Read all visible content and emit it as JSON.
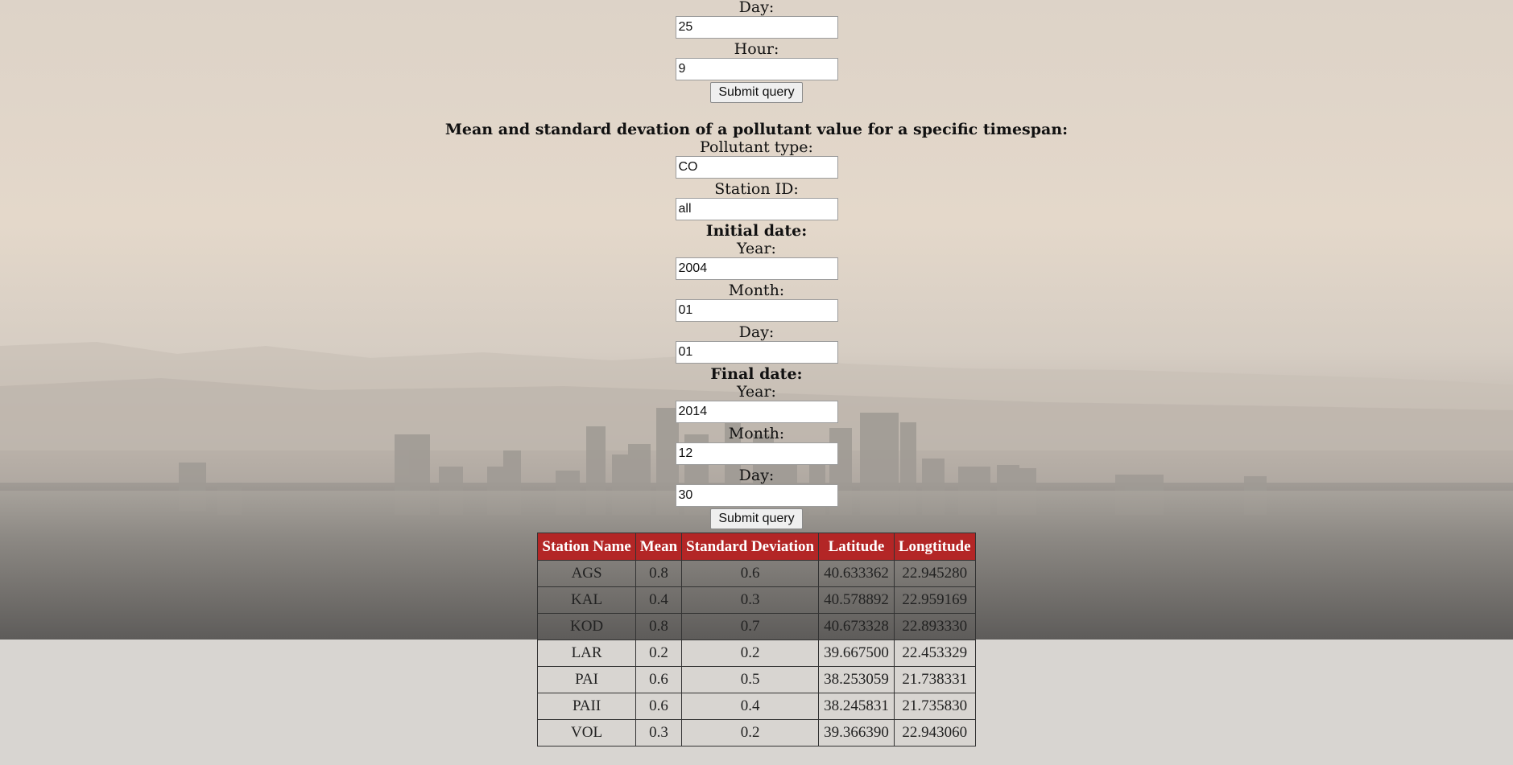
{
  "query1": {
    "day_label": "Day:",
    "day_value": "25",
    "hour_label": "Hour:",
    "hour_value": "9",
    "submit_label": "Submit query"
  },
  "query2": {
    "title": "Mean and standard devation of a pollutant value for a specific timespan:",
    "pollutant_label": "Pollutant type:",
    "pollutant_value": "CO",
    "station_label": "Station ID:",
    "station_value": "all",
    "initial_label": "Initial date:",
    "initial_year_label": "Year:",
    "initial_year_value": "2004",
    "initial_month_label": "Month:",
    "initial_month_value": "01",
    "initial_day_label": "Day:",
    "initial_day_value": "01",
    "final_label": "Final date:",
    "final_year_label": "Year:",
    "final_year_value": "2014",
    "final_month_label": "Month:",
    "final_month_value": "12",
    "final_day_label": "Day:",
    "final_day_value": "30",
    "submit_label": "Submit query"
  },
  "table": {
    "headers": [
      "Station Name",
      "Mean",
      "Standard Deviation",
      "Latitude",
      "Longtitude"
    ],
    "rows": [
      [
        "AGS",
        "0.8",
        "0.6",
        "40.633362",
        "22.945280"
      ],
      [
        "KAL",
        "0.4",
        "0.3",
        "40.578892",
        "22.959169"
      ],
      [
        "KOD",
        "0.8",
        "0.7",
        "40.673328",
        "22.893330"
      ],
      [
        "LAR",
        "0.2",
        "0.2",
        "39.667500",
        "22.453329"
      ],
      [
        "PAI",
        "0.6",
        "0.5",
        "38.253059",
        "21.738331"
      ],
      [
        "PAII",
        "0.6",
        "0.4",
        "38.245831",
        "21.735830"
      ],
      [
        "VOL",
        "0.3",
        "0.2",
        "39.366390",
        "22.943060"
      ]
    ]
  },
  "colors": {
    "table_header_bg": "#b32626",
    "table_header_text": "#ffffff"
  }
}
